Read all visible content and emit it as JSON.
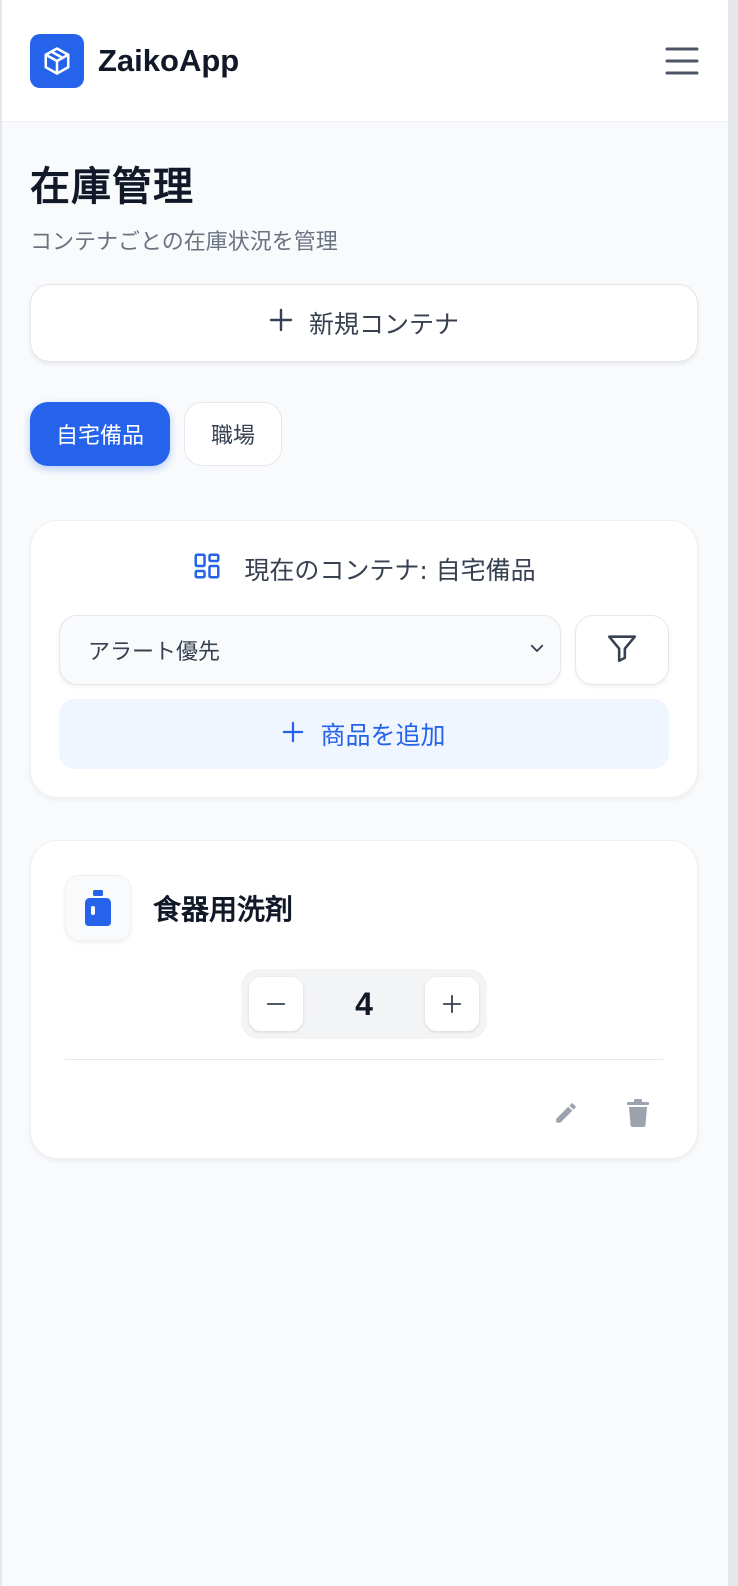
{
  "app": {
    "name": "ZaikoApp",
    "brand_color": "#2563eb"
  },
  "header": {
    "logo_icon": "cube-icon",
    "menu_icon": "hamburger-menu-icon"
  },
  "page": {
    "title": "在庫管理",
    "subtitle": "コンテナごとの在庫状況を管理"
  },
  "new_container": {
    "icon": "plus-icon",
    "label": "新規コンテナ"
  },
  "tabs": [
    {
      "label": "自宅備品",
      "active": true
    },
    {
      "label": "職場",
      "active": false
    }
  ],
  "current_container": {
    "icon": "grid-layout-icon",
    "label": "現在のコンテナ: 自宅備品",
    "sort_select": {
      "value": "アラート優先",
      "icon": "chevron-down-icon"
    },
    "filter_icon": "filter-icon",
    "add_item": {
      "icon": "plus-icon",
      "label": "商品を追加"
    }
  },
  "items": [
    {
      "name": "食器用洗剤",
      "icon": "detergent-bottle-icon",
      "quantity": "4",
      "decrement_icon": "minus-icon",
      "increment_icon": "plus-icon",
      "edit_icon": "pencil-icon",
      "delete_icon": "trash-icon"
    }
  ]
}
